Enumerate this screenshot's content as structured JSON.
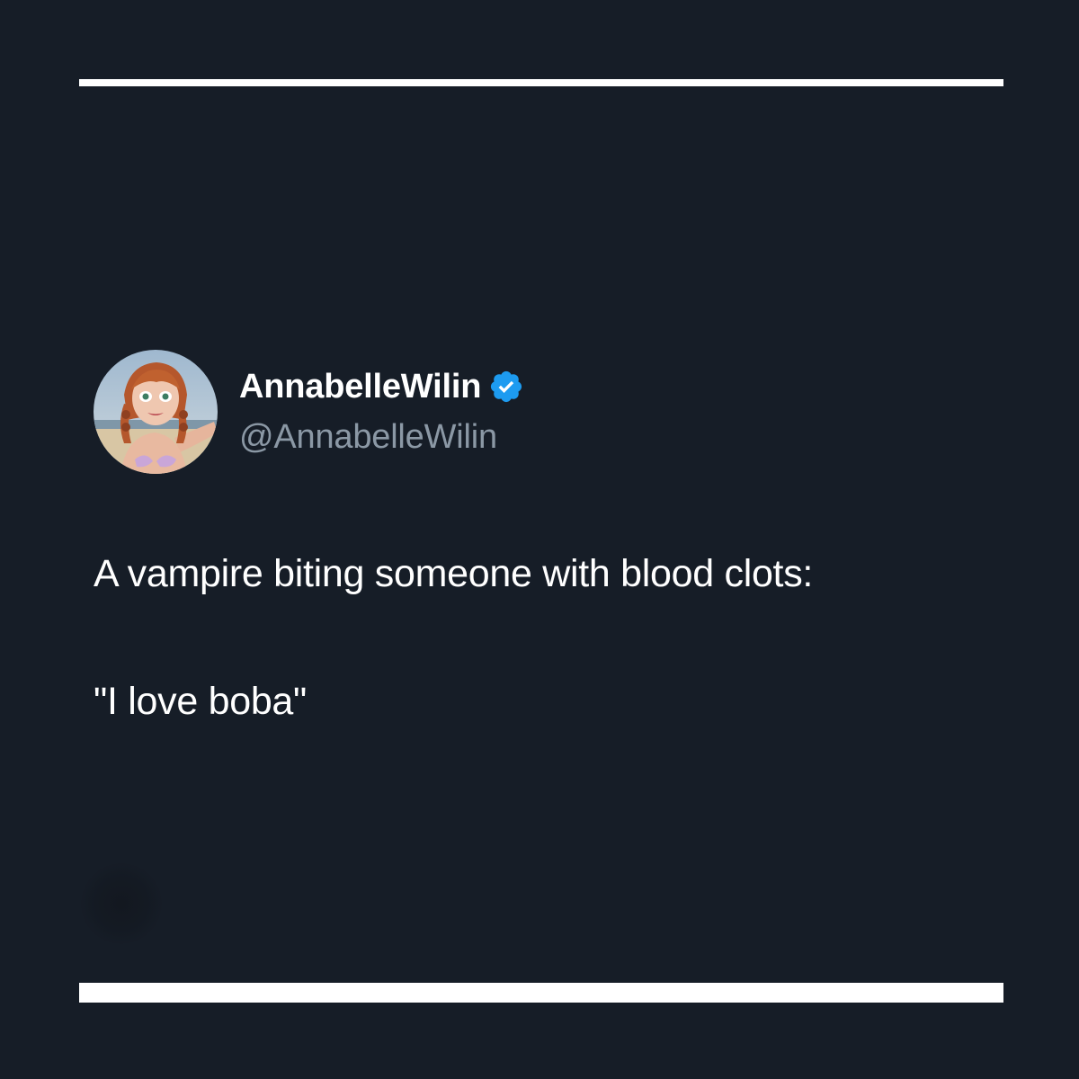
{
  "tweet": {
    "author": {
      "display_name": "AnnabelleWilin",
      "handle": "@AnnabelleWilin",
      "verified": true,
      "verified_color": "#1d9bf0",
      "avatar_icon": "doll-avatar"
    },
    "text_line_1": "A vampire biting someone with blood clots:",
    "text_line_2": "\"I love boba\""
  },
  "theme": {
    "background": "#161d27",
    "rule_color": "#ffffff",
    "text_primary": "#ffffff",
    "text_secondary": "#8b98a5"
  }
}
